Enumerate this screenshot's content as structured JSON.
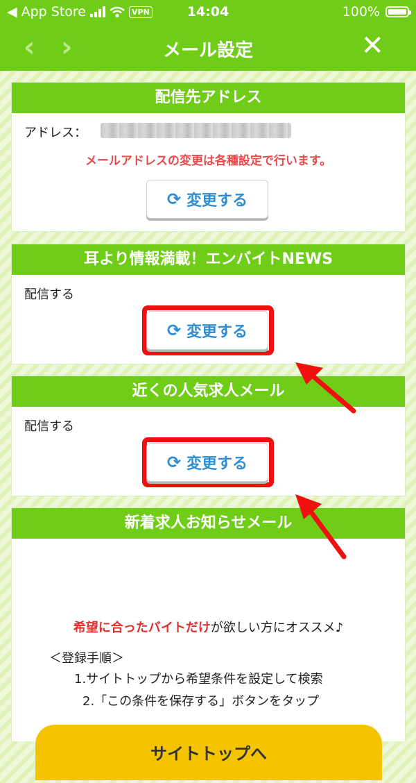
{
  "status_bar": {
    "back_app": "App Store",
    "vpn": "VPN",
    "time": "14:04",
    "battery": "100%"
  },
  "navbar": {
    "title": "メール設定",
    "back_glyph": "‹",
    "forward_glyph": "›",
    "close_glyph": "✕"
  },
  "cards": {
    "address": {
      "header": "配信先アドレス",
      "label": "アドレス：",
      "notice": "メールアドレスの変更は各種設定で行います。",
      "button": "変更する"
    },
    "news": {
      "header": "耳より情報満載！エンバイトNEWS",
      "status": "配信する",
      "button": "変更する"
    },
    "nearby": {
      "header": "近くの人気求人メール",
      "status": "配信する",
      "button": "変更する"
    },
    "new_jobs": {
      "header": "新着求人お知らせメール",
      "promo_highlight": "希望に合ったバイトだけ",
      "promo_rest": "が欲しい方にオススメ♪",
      "steps_title": "＜登録手順＞",
      "step1": "1.サイトトップから希望条件を設定して検索",
      "step2": "2.「この条件を保存する」ボタンをタップ",
      "site_button": "サイトトップへ"
    }
  },
  "icons": {
    "refresh": "refresh-icon"
  },
  "colors": {
    "brand_green": "#6fcd18",
    "link_blue": "#2f8ed0",
    "notice_red": "#e64a4a",
    "highlight_red": "#f01010",
    "cta_yellow": "#f5c400"
  }
}
